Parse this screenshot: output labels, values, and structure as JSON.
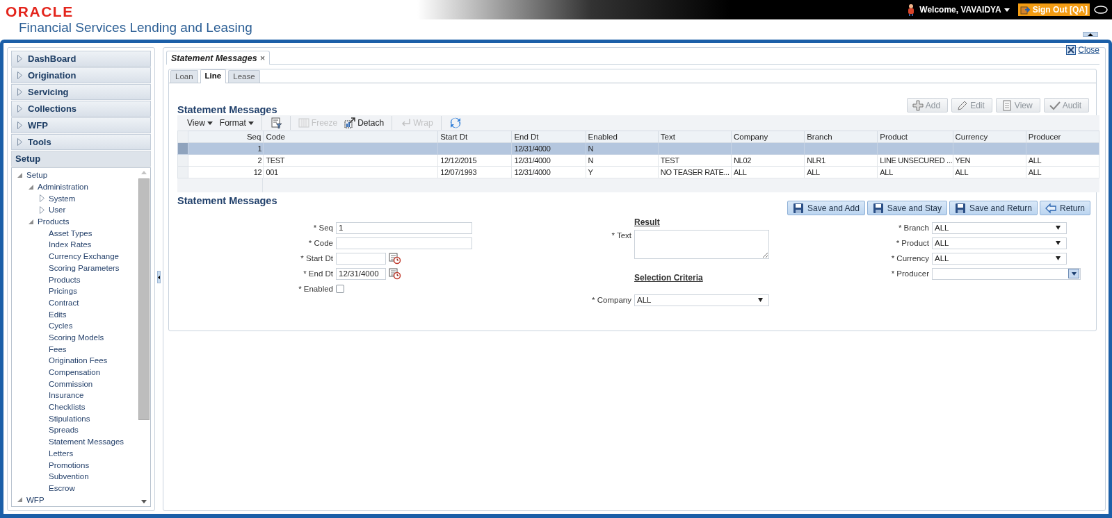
{
  "header": {
    "logo": "ORACLE",
    "product": "Financial Services Lending and Leasing",
    "welcome": "Welcome, VAVAIDYA",
    "sign_out": "Sign Out [QA]"
  },
  "nav": {
    "sections": [
      {
        "label": "DashBoard",
        "expanded": false
      },
      {
        "label": "Origination",
        "expanded": false
      },
      {
        "label": "Servicing",
        "expanded": false
      },
      {
        "label": "Collections",
        "expanded": false
      },
      {
        "label": "WFP",
        "expanded": false
      },
      {
        "label": "Tools",
        "expanded": false
      },
      {
        "label": "Setup",
        "expanded": true
      }
    ],
    "tree": [
      {
        "label": "Setup",
        "expanded": true,
        "children": [
          {
            "label": "Administration",
            "expanded": true,
            "children": [
              {
                "label": "System",
                "expanded": false
              },
              {
                "label": "User",
                "expanded": false
              }
            ]
          },
          {
            "label": "Products",
            "expanded": true,
            "children": [
              {
                "label": "Asset Types"
              },
              {
                "label": "Index Rates"
              },
              {
                "label": "Currency Exchange"
              },
              {
                "label": "Scoring Parameters"
              },
              {
                "label": "Products"
              },
              {
                "label": "Pricings"
              },
              {
                "label": "Contract"
              },
              {
                "label": "Edits"
              },
              {
                "label": "Cycles"
              },
              {
                "label": "Scoring Models"
              },
              {
                "label": "Fees"
              },
              {
                "label": "Origination Fees"
              },
              {
                "label": "Compensation"
              },
              {
                "label": "Commission"
              },
              {
                "label": "Insurance"
              },
              {
                "label": "Checklists"
              },
              {
                "label": "Stipulations"
              },
              {
                "label": "Spreads"
              },
              {
                "label": "Statement Messages"
              },
              {
                "label": "Letters"
              },
              {
                "label": "Promotions"
              },
              {
                "label": "Subvention"
              },
              {
                "label": "Escrow"
              }
            ]
          }
        ]
      },
      {
        "label": "WFP",
        "expanded": true
      }
    ]
  },
  "page_tab": {
    "label": "Statement Messages",
    "close": "×"
  },
  "close_link": "Close",
  "tabs": [
    {
      "label": "Loan",
      "selected": false
    },
    {
      "label": "Line",
      "selected": true
    },
    {
      "label": "Lease",
      "selected": false
    }
  ],
  "grid": {
    "title": "Statement Messages",
    "actions": [
      {
        "label": "Add",
        "kind": "add",
        "disabled": true
      },
      {
        "label": "Edit",
        "kind": "edit",
        "disabled": true
      },
      {
        "label": "View",
        "kind": "view",
        "disabled": true
      },
      {
        "label": "Audit",
        "kind": "audit",
        "disabled": true
      }
    ],
    "toolbar": [
      {
        "label": "View",
        "kind": "menu",
        "disabled": false
      },
      {
        "label": "Format",
        "kind": "menu",
        "disabled": false
      },
      {
        "kind": "filter",
        "disabled": false
      },
      {
        "label": "Freeze",
        "kind": "freeze",
        "disabled": true
      },
      {
        "label": "Detach",
        "kind": "detach",
        "disabled": false
      },
      {
        "label": "Wrap",
        "kind": "wrap",
        "disabled": true
      },
      {
        "kind": "refresh",
        "disabled": false
      }
    ],
    "columns": [
      {
        "label": "Seq",
        "kind": "number"
      },
      {
        "label": "Code",
        "kind": "text"
      },
      {
        "label": "Start Dt",
        "kind": "text"
      },
      {
        "label": "End Dt",
        "kind": "text"
      },
      {
        "label": "Enabled",
        "kind": "text"
      },
      {
        "label": "Text",
        "kind": "text"
      },
      {
        "label": "Company",
        "kind": "text"
      },
      {
        "label": "Branch",
        "kind": "text"
      },
      {
        "label": "Product",
        "kind": "text"
      },
      {
        "label": "Currency",
        "kind": "text"
      },
      {
        "label": "Producer",
        "kind": "text"
      }
    ],
    "rows": [
      {
        "selected": true,
        "cells": [
          "1",
          null,
          null,
          "12/31/4000",
          "N",
          null,
          null,
          null,
          null,
          null,
          null
        ]
      },
      {
        "selected": false,
        "cells": [
          "2",
          "TEST",
          "12/12/2015",
          "12/31/4000",
          "N",
          "TEST",
          "NL02",
          "NLR1",
          "LINE UNSECURED ...",
          "YEN",
          "ALL"
        ]
      },
      {
        "selected": false,
        "cells": [
          "12",
          "001",
          "12/07/1993",
          "12/31/4000",
          "Y",
          "NO TEASER RATE...",
          "ALL",
          "ALL",
          "ALL",
          "ALL",
          "ALL"
        ]
      }
    ]
  },
  "form": {
    "title": "Statement Messages",
    "buttons": [
      {
        "label": "Save and Add",
        "kind": "save"
      },
      {
        "label": "Save and Stay",
        "kind": "save"
      },
      {
        "label": "Save and Return",
        "kind": "save"
      },
      {
        "label": "Return",
        "kind": "back"
      }
    ],
    "left": [
      {
        "label": "* Seq",
        "kind": "text",
        "value": "1"
      },
      {
        "label": "* Code",
        "kind": "text"
      },
      {
        "label": "* Start Dt",
        "kind": "date"
      },
      {
        "label": "* End Dt",
        "kind": "date",
        "value": "12/31/4000"
      },
      {
        "label": "* Enabled",
        "kind": "checkbox",
        "checked": false
      }
    ],
    "result_heading": "Result",
    "text_field": {
      "label": "* Text"
    },
    "criteria_heading": "Selection Criteria",
    "company": {
      "label": "* Company",
      "value": "ALL"
    },
    "right": [
      {
        "label": "* Branch",
        "kind": "select",
        "value": "ALL"
      },
      {
        "label": "* Product",
        "kind": "select",
        "value": "ALL"
      },
      {
        "label": "* Currency",
        "kind": "select",
        "value": "ALL"
      },
      {
        "label": "* Producer",
        "kind": "combo"
      }
    ]
  }
}
